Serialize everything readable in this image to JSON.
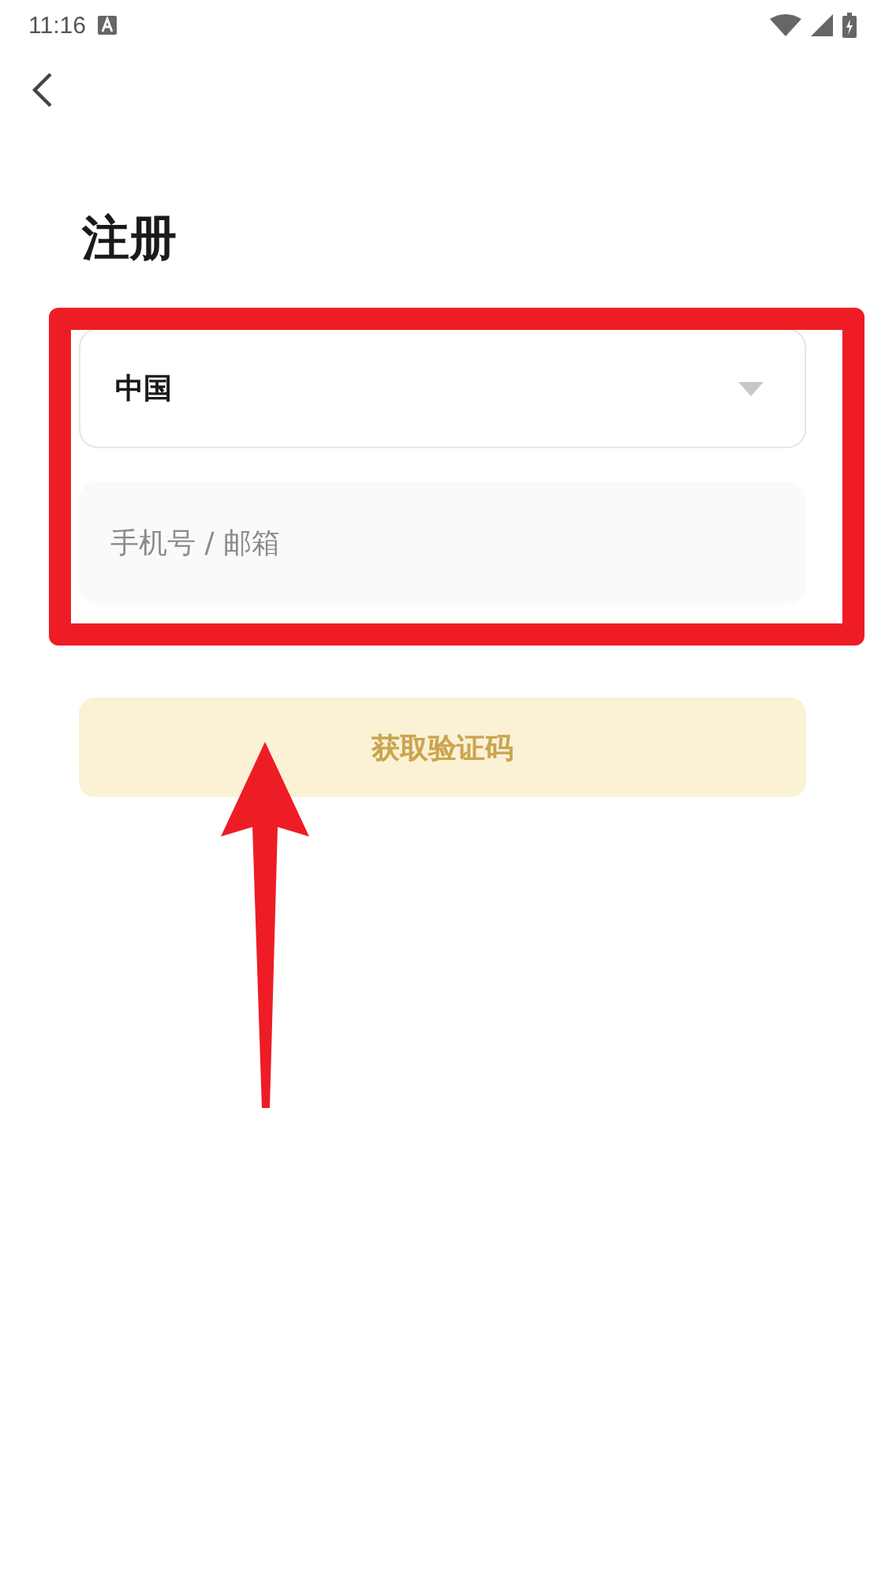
{
  "status_bar": {
    "time": "11:16"
  },
  "title": "注册",
  "country_select": {
    "value": "中国"
  },
  "account_field": {
    "placeholder": "手机号 / 邮箱"
  },
  "submit_button": {
    "label": "获取验证码",
    "disabled": true
  }
}
